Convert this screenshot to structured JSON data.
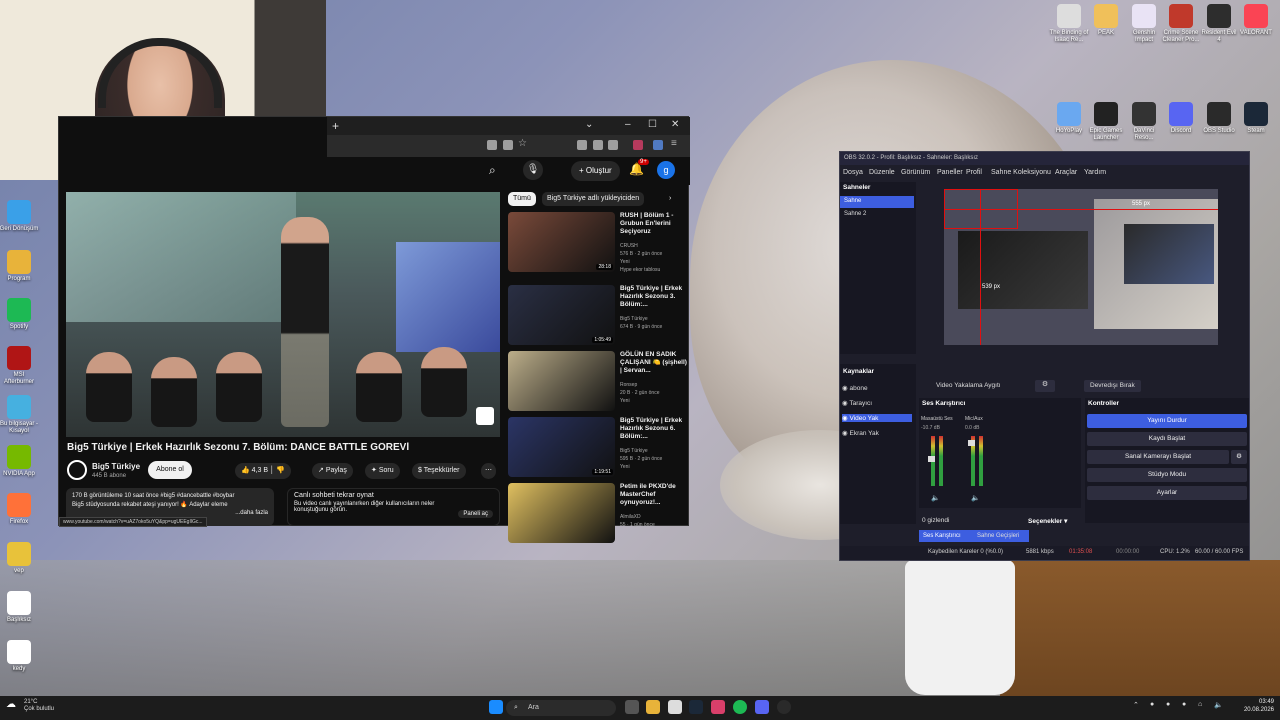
{
  "weather": {
    "temp": "21°C",
    "desc": "Çok bulutlu"
  },
  "desktop_icons_left": [
    {
      "label": "Geri Dönüşüm",
      "color": "#3aa0e8"
    },
    {
      "label": "Program",
      "color": "#e8b33a"
    },
    {
      "label": "Spotify",
      "color": "#1db954"
    },
    {
      "label": "MSI Afterburner",
      "color": "#b01515"
    },
    {
      "label": "Bu bilgisayar - Kısayol",
      "color": "#46b0e0"
    },
    {
      "label": "NVIDIA App",
      "color": "#76b900"
    },
    {
      "label": "Firefox",
      "color": "#ff7139"
    },
    {
      "label": "vep",
      "color": "#e8c23a"
    },
    {
      "label": "Başlıksız",
      "color": "#ffffff"
    },
    {
      "label": "kedy",
      "color": "#ffffff"
    }
  ],
  "desktop_icons_top": [
    {
      "label": "The Binding of Isaac Re...",
      "color": "#dddddd"
    },
    {
      "label": "PEAK",
      "color": "#f0c05a"
    },
    {
      "label": "Genshin Impact",
      "color": "#e9e3f5"
    },
    {
      "label": "Crime Scene Cleaner Pro...",
      "color": "#c0392b"
    },
    {
      "label": "Resident Evil 4",
      "color": "#2d2d2d"
    },
    {
      "label": "VALORANT",
      "color": "#fa4454"
    }
  ],
  "desktop_icons_row2": [
    {
      "label": "HoYoPlay",
      "color": "#6aa8f0"
    },
    {
      "label": "Epic Games Launcher",
      "color": "#222222"
    },
    {
      "label": "DaVinci Reso...",
      "color": "#333333"
    },
    {
      "label": "Discord",
      "color": "#5865f2"
    },
    {
      "label": "OBS Studio",
      "color": "#2a2a2a"
    },
    {
      "label": "Steam",
      "color": "#1b2838"
    }
  ],
  "browser": {
    "create_label": "Oluştur",
    "notif_count": "9+",
    "avatar_letter": "g",
    "video": {
      "title": "Big5 Türkiye | Erkek Hazırlık Sezonu 7. Bölüm: DANCE BATTLE GÖREVİ",
      "channel": "Big5 Türkiye",
      "subs": "445 B abone",
      "subscribe": "Abone ol",
      "likes": "4,3 B",
      "share": "Paylaş",
      "ask": "Soru",
      "thanks": "Teşekkürler",
      "desc_line1": "170 B görüntüleme  10 saat önce  #big5 #dancebattle #boybar",
      "desc_line2": "Big5 stüdyosunda rekabet ateşi yanıyor! 🔥 Adaylar eleme",
      "desc_more": "...daha fazla",
      "chat_title": "Canlı sohbeti tekrar oynat",
      "chat_body": "Bu video canlı yayınlanırken diğer kullanıcıların neler konuştuğunu görün.",
      "chat_btn": "Paneli aç",
      "status_url": "www.youtube.com/watch?v=uAZ7oko5uYQ&pp=ugUEEgIlGc..."
    },
    "chips": [
      "Tümü",
      "Big5 Türkiye adlı yükleyiciden"
    ],
    "recommendations": [
      {
        "title": "RUSH | Bölüm 1 - Grubun En'lerini Seçiyoruz",
        "channel": "CRUSH",
        "meta": "576 B · 2 gün önce",
        "extra": "Yeni",
        "extra2": "Hype ekor tablosu",
        "duration": "28:18",
        "color": "#7a4a3a"
      },
      {
        "title": "Big5 Türkiye | Erkek Hazırlık Sezonu 3. Bölüm:...",
        "channel": "Big5 Türkiye",
        "meta": "674 B · 9 gün önce",
        "extra": "",
        "extra2": "",
        "duration": "1:05:49",
        "color": "#2a2f44"
      },
      {
        "title": "GÖLÜN EN SADIK ÇALIŞANI 🍋 (şişhell) | Servan...",
        "channel": "Ronsep",
        "meta": "20 B · 2 gün önce",
        "extra": "Yeni",
        "extra2": "",
        "duration": "",
        "color": "#bcae8a"
      },
      {
        "title": "Big5 Türkiye | Erkek Hazırlık Sezonu 6. Bölüm:...",
        "channel": "Big5 Türkiye",
        "meta": "595 B · 2 gün önce",
        "extra": "Yeni",
        "extra2": "",
        "duration": "1:19:51",
        "color": "#2b3566"
      },
      {
        "title": "Petim ile PKXD'de MasterChef oynuyoruz!...",
        "channel": "AlmilaXD",
        "meta": "55 · 1 gün önce",
        "extra": "",
        "extra2": "",
        "duration": "",
        "color": "#e0c060"
      }
    ]
  },
  "obs": {
    "title": "OBS 32.0.2 - Profil: Başlıksız - Sahneler: Başlıksız",
    "menu": [
      "Dosya",
      "Düzenle",
      "Görünüm",
      "Paneller",
      "Profil",
      "Sahne Koleksiyonu",
      "Araçlar",
      "Yardım"
    ],
    "scenes_title": "Sahneler",
    "scenes": [
      "Sahne",
      "Sahne 2"
    ],
    "sources_title": "Kaynaklar",
    "sources": [
      "abone",
      "Tarayıcı",
      "Video Yak",
      "Ekran Yak"
    ],
    "preview_dim1": "555 px",
    "preview_dim2": "539 px",
    "source_toolbar_label": "Video Yakalama Aygıtı",
    "deactivate": "Devredışı Bırak",
    "mixer_title": "Ses Karıştırıcı",
    "mixer_channels": [
      {
        "name": "Masaüstü Ses",
        "db": "-10.7 dB"
      },
      {
        "name": "Mic/Aux",
        "db": "0.0 dB"
      }
    ],
    "hidden_count": "0 gizlendi",
    "options": "Seçenekler",
    "controls_title": "Kontroller",
    "controls": [
      "Yayını Durdur",
      "Kaydı Başlat",
      "Sanal Kamerayı Başlat",
      "Stüdyo Modu",
      "Ayarlar"
    ],
    "tabs": [
      "Ses Karıştırıcı",
      "Sahne Geçişleri"
    ],
    "status": {
      "dropped": "Kaybedilen Kareler 0 (%0.0)",
      "kbps": "5881 kbps",
      "live_time": "01:35:08",
      "rec_time": "00:00:00",
      "cpu": "CPU: 1.2%",
      "fps": "60.00 / 60.00 FPS"
    }
  },
  "taskbar": {
    "search_label": "Ara",
    "time": "03:49",
    "date": "20.08.2026"
  }
}
